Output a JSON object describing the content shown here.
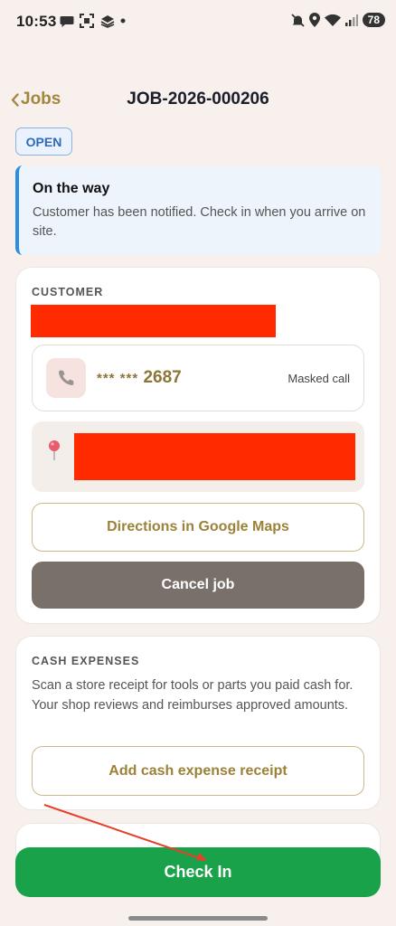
{
  "status_bar": {
    "time": "10:53",
    "battery": "78",
    "icons_left": [
      "chat-bubble-icon",
      "screenshot-icon",
      "stack-icon",
      "dot-icon"
    ],
    "icons_right": [
      "mute-icon",
      "location-icon",
      "wifi-icon",
      "signal-icon",
      "battery-icon"
    ]
  },
  "header": {
    "back_label": "Jobs",
    "title": "JOB-2026-000206"
  },
  "status_badge": "OPEN",
  "banner": {
    "title": "On the way",
    "text": "Customer has been notified. Check in when you arrive on site."
  },
  "customer": {
    "section_label": "CUSTOMER",
    "phone_masked": "*** ***",
    "phone_last4": "2687",
    "masked_call_label": "Masked call",
    "directions_label": "Directions in Google Maps",
    "cancel_label": "Cancel job"
  },
  "cash_expenses": {
    "section_label": "CASH EXPENSES",
    "description": "Scan a store receipt for tools or parts you paid cash for. Your shop reviews and reimburses approved amounts.",
    "add_receipt_label": "Add cash expense receipt"
  },
  "check_in_label": "Check In",
  "colors": {
    "accent_gold": "#9c8138",
    "primary_green": "#1aa24a",
    "info_blue": "#2d8de0",
    "cancel_gray": "#7a706a"
  }
}
